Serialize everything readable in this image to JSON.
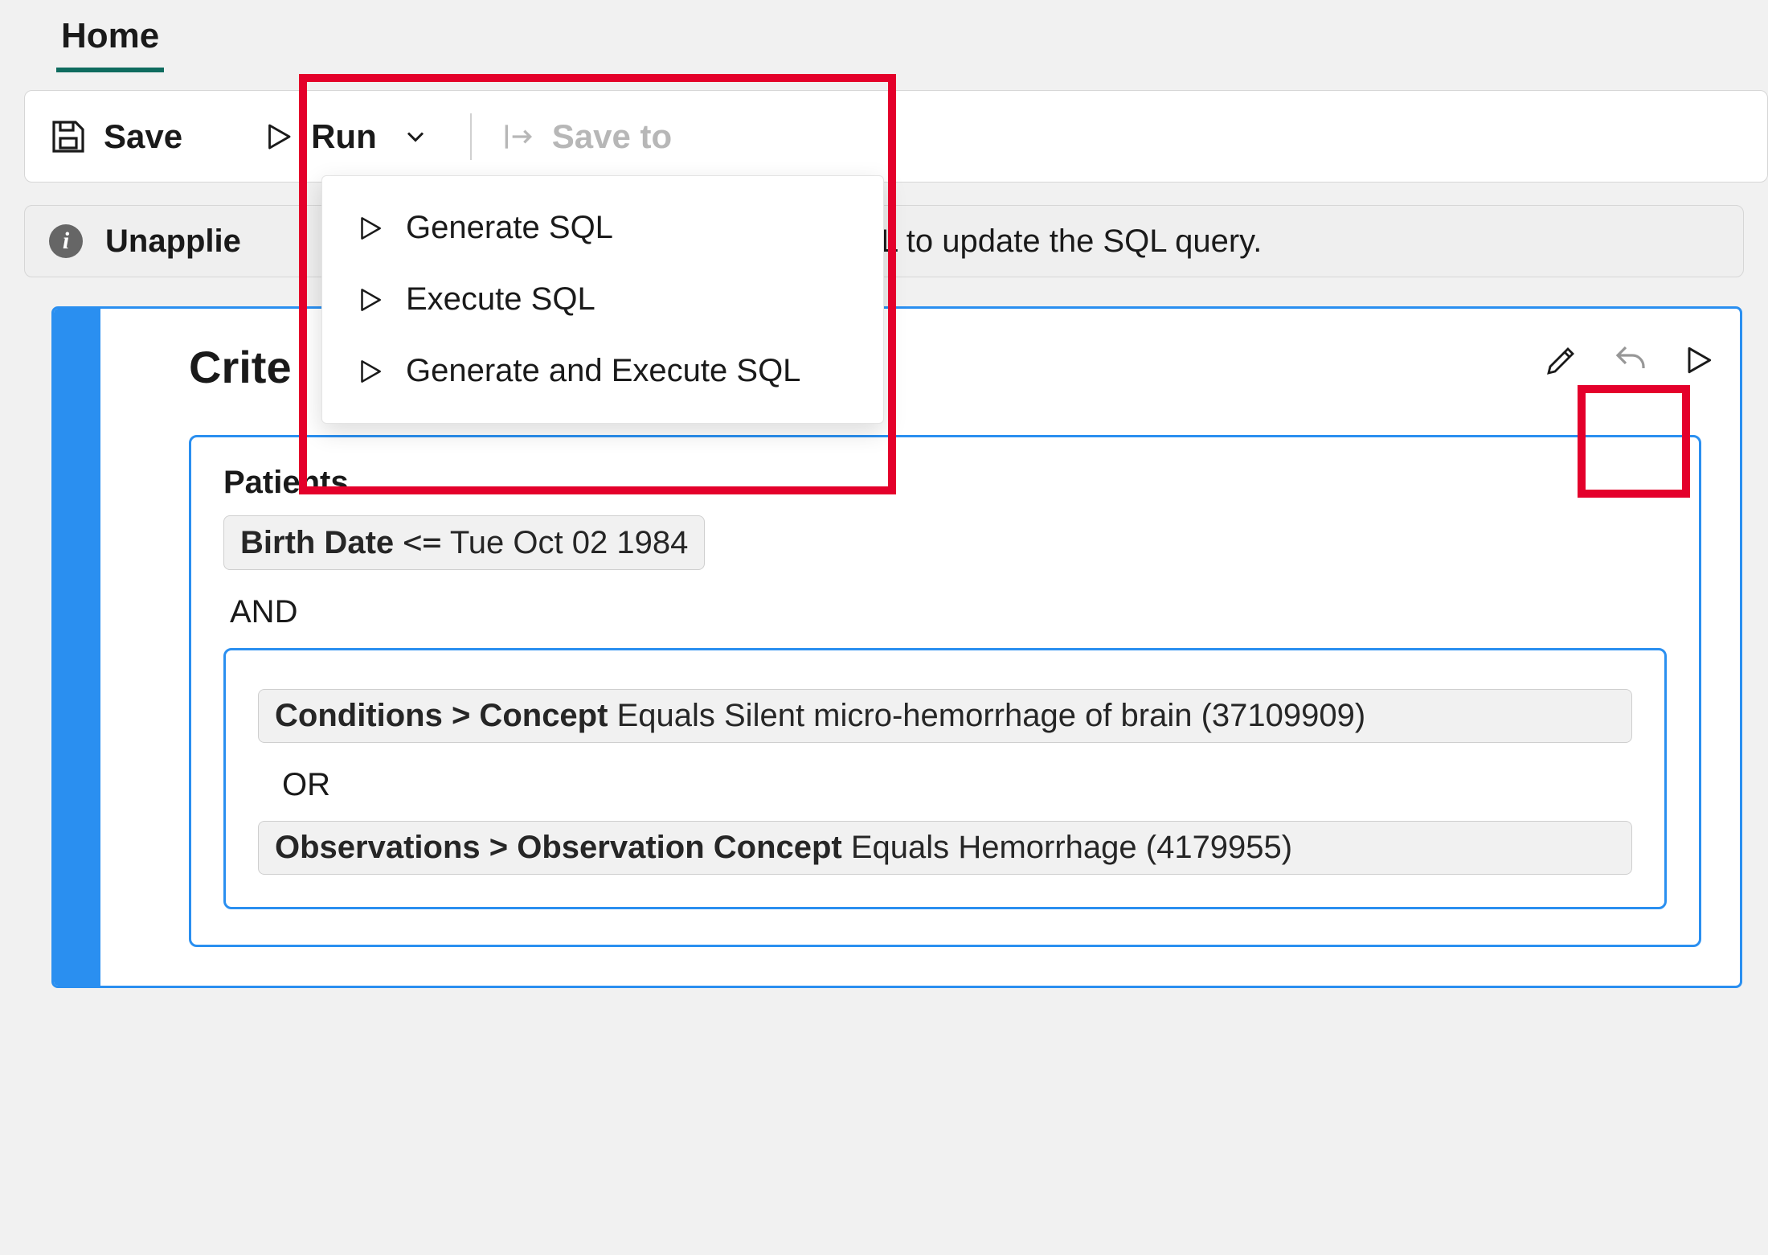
{
  "tabs": {
    "home": "Home"
  },
  "toolbar": {
    "save_label": "Save",
    "run_label": "Run",
    "save_to_label": "Save to"
  },
  "run_menu": {
    "generate_sql": "Generate SQL",
    "execute_sql": "Execute SQL",
    "generate_and_execute_sql": "Generate and Execute SQL"
  },
  "info": {
    "prefix": "Unapplie",
    "suffix": "L to update the SQL query."
  },
  "criteria": {
    "title": "Crite",
    "patients_heading": "Patients",
    "birth_chip": {
      "field": "Birth Date",
      "operator": "<=",
      "value": "Tue Oct 02 1984"
    },
    "logical_and": "AND",
    "conditions_chip": {
      "path": "Conditions > Concept",
      "operator_text": "Equals",
      "value": "Silent micro-hemorrhage of brain (37109909)"
    },
    "logical_or": "OR",
    "observations_chip": {
      "path": "Observations > Observation Concept",
      "operator_text": "Equals",
      "value": "Hemorrhage (4179955)"
    }
  },
  "icons": {
    "info_char": "i"
  },
  "colors": {
    "accent": "#2a8ff0",
    "highlight": "#e4002b"
  }
}
